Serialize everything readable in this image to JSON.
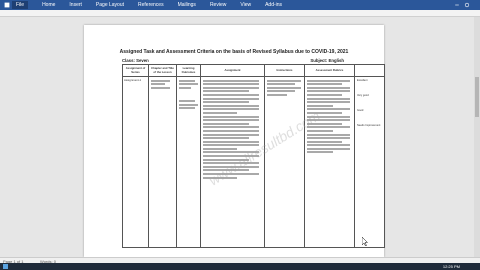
{
  "ribbon": {
    "tabs": [
      "File",
      "Home",
      "Insert",
      "Page Layout",
      "References",
      "Mailings",
      "Review",
      "View",
      "Add-ins"
    ]
  },
  "document": {
    "title": "Assigned Task and Assessment Criteria on the basis of Revised Syllabus due to COVID-19, 2021",
    "class_label": "Class: Seven",
    "subject_label": "Subject: English",
    "table_headers": [
      "Assignment of Series",
      "Chapter and Title of the Lesson",
      "Learning Outcomes",
      "Assignment",
      "Instructions",
      "Assessment Rubrics",
      ""
    ],
    "row1_col1": "Assignment-1",
    "side_labels": [
      "Excellent",
      "Very good",
      "Good",
      "Needs Improvement"
    ],
    "watermark": "www.allresultbd.com"
  },
  "statusbar": {
    "page": "Page 1 of 1",
    "words": "Words: 0"
  },
  "taskbar": {
    "time": "12:25 PM"
  }
}
